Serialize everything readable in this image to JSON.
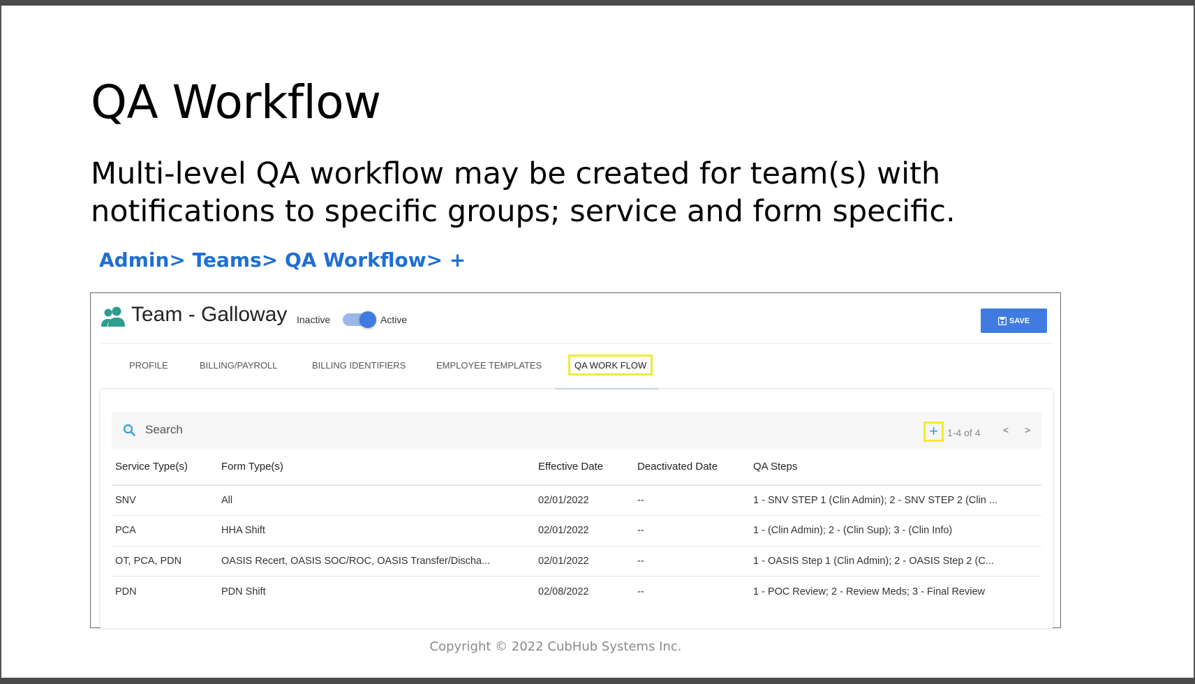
{
  "slide": {
    "title": "QA Workflow",
    "subtitle": "Multi-level QA workflow may be created for team(s) with notifications to specific groups; service and form specific.",
    "breadcrumb": "Admin> Teams> QA Workflow> +",
    "copyright": "Copyright © 2022 CubHub Systems Inc."
  },
  "header": {
    "team_name": "Team - Galloway",
    "inactive_label": "Inactive",
    "active_label": "Active",
    "active": true,
    "save_label": "SAVE"
  },
  "tabs": [
    {
      "label": "PROFILE"
    },
    {
      "label": "BILLING/PAYROLL"
    },
    {
      "label": "BILLING IDENTIFIERS"
    },
    {
      "label": "EMPLOYEE TEMPLATES"
    },
    {
      "label": "QA WORK FLOW",
      "selected": true
    }
  ],
  "toolbar": {
    "search_placeholder": "Search",
    "add_label": "+",
    "pagination": "1-4 of 4",
    "prev_label": "<",
    "next_label": ">"
  },
  "table": {
    "headers": [
      "Service Type(s)",
      "Form Type(s)",
      "Effective Date",
      "Deactivated Date",
      "QA Steps"
    ],
    "rows": [
      [
        "SNV",
        "All",
        "02/01/2022",
        "--",
        "1 - SNV STEP 1 (Clin Admin); 2 - SNV STEP 2 (Clin ..."
      ],
      [
        "PCA",
        "HHA Shift",
        "02/01/2022",
        "--",
        "1 - (Clin Admin); 2 - (Clin Sup); 3 - (Clin Info)"
      ],
      [
        "OT, PCA, PDN",
        "OASIS Recert, OASIS SOC/ROC, OASIS Transfer/Discha...",
        "02/01/2022",
        "--",
        "1 - OASIS Step 1 (Clin Admin); 2 - OASIS Step 2 (C..."
      ],
      [
        "PDN",
        "PDN Shift",
        "02/08/2022",
        "--",
        "1 - POC Review; 2 - Review Meds; 3 - Final Review"
      ]
    ]
  },
  "colors": {
    "accent": "#3f7be0",
    "breadcrumb": "#1f6fd1",
    "highlight": "#f2ea32",
    "team_icon": "#2e9c8f"
  },
  "icons": {
    "team": "people-icon",
    "save": "floppy-disk-icon",
    "search": "search-icon"
  }
}
